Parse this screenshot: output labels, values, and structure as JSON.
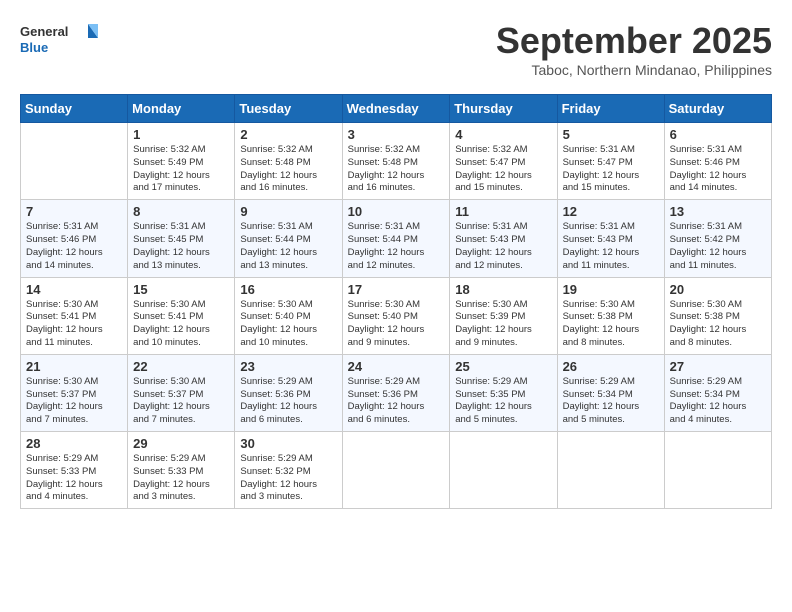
{
  "header": {
    "logo_general": "General",
    "logo_blue": "Blue",
    "month": "September 2025",
    "location": "Taboc, Northern Mindanao, Philippines"
  },
  "weekdays": [
    "Sunday",
    "Monday",
    "Tuesday",
    "Wednesday",
    "Thursday",
    "Friday",
    "Saturday"
  ],
  "weeks": [
    [
      {
        "day": "",
        "info": ""
      },
      {
        "day": "1",
        "info": "Sunrise: 5:32 AM\nSunset: 5:49 PM\nDaylight: 12 hours\nand 17 minutes."
      },
      {
        "day": "2",
        "info": "Sunrise: 5:32 AM\nSunset: 5:48 PM\nDaylight: 12 hours\nand 16 minutes."
      },
      {
        "day": "3",
        "info": "Sunrise: 5:32 AM\nSunset: 5:48 PM\nDaylight: 12 hours\nand 16 minutes."
      },
      {
        "day": "4",
        "info": "Sunrise: 5:32 AM\nSunset: 5:47 PM\nDaylight: 12 hours\nand 15 minutes."
      },
      {
        "day": "5",
        "info": "Sunrise: 5:31 AM\nSunset: 5:47 PM\nDaylight: 12 hours\nand 15 minutes."
      },
      {
        "day": "6",
        "info": "Sunrise: 5:31 AM\nSunset: 5:46 PM\nDaylight: 12 hours\nand 14 minutes."
      }
    ],
    [
      {
        "day": "7",
        "info": "Sunrise: 5:31 AM\nSunset: 5:46 PM\nDaylight: 12 hours\nand 14 minutes."
      },
      {
        "day": "8",
        "info": "Sunrise: 5:31 AM\nSunset: 5:45 PM\nDaylight: 12 hours\nand 13 minutes."
      },
      {
        "day": "9",
        "info": "Sunrise: 5:31 AM\nSunset: 5:44 PM\nDaylight: 12 hours\nand 13 minutes."
      },
      {
        "day": "10",
        "info": "Sunrise: 5:31 AM\nSunset: 5:44 PM\nDaylight: 12 hours\nand 12 minutes."
      },
      {
        "day": "11",
        "info": "Sunrise: 5:31 AM\nSunset: 5:43 PM\nDaylight: 12 hours\nand 12 minutes."
      },
      {
        "day": "12",
        "info": "Sunrise: 5:31 AM\nSunset: 5:43 PM\nDaylight: 12 hours\nand 11 minutes."
      },
      {
        "day": "13",
        "info": "Sunrise: 5:31 AM\nSunset: 5:42 PM\nDaylight: 12 hours\nand 11 minutes."
      }
    ],
    [
      {
        "day": "14",
        "info": "Sunrise: 5:30 AM\nSunset: 5:41 PM\nDaylight: 12 hours\nand 11 minutes."
      },
      {
        "day": "15",
        "info": "Sunrise: 5:30 AM\nSunset: 5:41 PM\nDaylight: 12 hours\nand 10 minutes."
      },
      {
        "day": "16",
        "info": "Sunrise: 5:30 AM\nSunset: 5:40 PM\nDaylight: 12 hours\nand 10 minutes."
      },
      {
        "day": "17",
        "info": "Sunrise: 5:30 AM\nSunset: 5:40 PM\nDaylight: 12 hours\nand 9 minutes."
      },
      {
        "day": "18",
        "info": "Sunrise: 5:30 AM\nSunset: 5:39 PM\nDaylight: 12 hours\nand 9 minutes."
      },
      {
        "day": "19",
        "info": "Sunrise: 5:30 AM\nSunset: 5:38 PM\nDaylight: 12 hours\nand 8 minutes."
      },
      {
        "day": "20",
        "info": "Sunrise: 5:30 AM\nSunset: 5:38 PM\nDaylight: 12 hours\nand 8 minutes."
      }
    ],
    [
      {
        "day": "21",
        "info": "Sunrise: 5:30 AM\nSunset: 5:37 PM\nDaylight: 12 hours\nand 7 minutes."
      },
      {
        "day": "22",
        "info": "Sunrise: 5:30 AM\nSunset: 5:37 PM\nDaylight: 12 hours\nand 7 minutes."
      },
      {
        "day": "23",
        "info": "Sunrise: 5:29 AM\nSunset: 5:36 PM\nDaylight: 12 hours\nand 6 minutes."
      },
      {
        "day": "24",
        "info": "Sunrise: 5:29 AM\nSunset: 5:36 PM\nDaylight: 12 hours\nand 6 minutes."
      },
      {
        "day": "25",
        "info": "Sunrise: 5:29 AM\nSunset: 5:35 PM\nDaylight: 12 hours\nand 5 minutes."
      },
      {
        "day": "26",
        "info": "Sunrise: 5:29 AM\nSunset: 5:34 PM\nDaylight: 12 hours\nand 5 minutes."
      },
      {
        "day": "27",
        "info": "Sunrise: 5:29 AM\nSunset: 5:34 PM\nDaylight: 12 hours\nand 4 minutes."
      }
    ],
    [
      {
        "day": "28",
        "info": "Sunrise: 5:29 AM\nSunset: 5:33 PM\nDaylight: 12 hours\nand 4 minutes."
      },
      {
        "day": "29",
        "info": "Sunrise: 5:29 AM\nSunset: 5:33 PM\nDaylight: 12 hours\nand 3 minutes."
      },
      {
        "day": "30",
        "info": "Sunrise: 5:29 AM\nSunset: 5:32 PM\nDaylight: 12 hours\nand 3 minutes."
      },
      {
        "day": "",
        "info": ""
      },
      {
        "day": "",
        "info": ""
      },
      {
        "day": "",
        "info": ""
      },
      {
        "day": "",
        "info": ""
      }
    ]
  ]
}
